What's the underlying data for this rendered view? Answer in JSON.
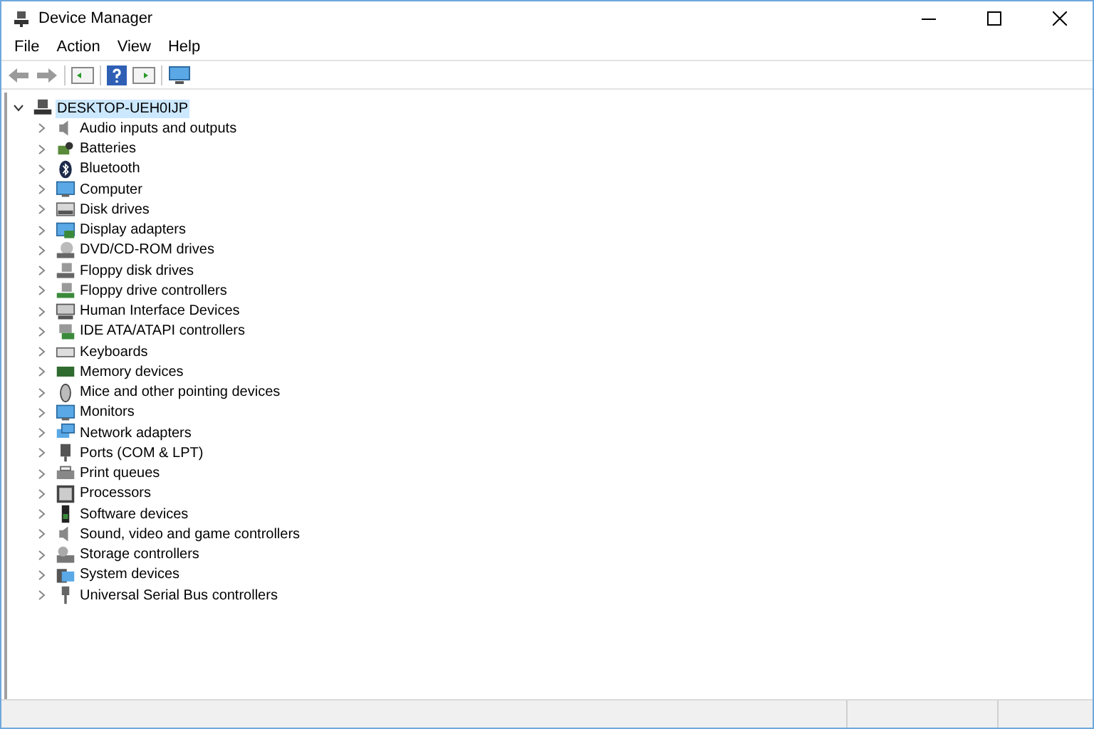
{
  "window": {
    "title": "Device Manager"
  },
  "menu": [
    "File",
    "Action",
    "View",
    "Help"
  ],
  "tree": {
    "label": "DESKTOP-UEH0IJP",
    "expanded": true,
    "selected": true,
    "children": [
      {
        "label": "Audio inputs and outputs",
        "expanded": false,
        "selected": false
      },
      {
        "label": "Batteries",
        "expanded": false,
        "selected": false
      },
      {
        "label": "Bluetooth",
        "expanded": false,
        "selected": false
      },
      {
        "label": "Computer",
        "expanded": false,
        "selected": false
      },
      {
        "label": "Disk drives",
        "expanded": false,
        "selected": false
      },
      {
        "label": "Display adapters",
        "expanded": false,
        "selected": false
      },
      {
        "label": "DVD/CD-ROM drives",
        "expanded": false,
        "selected": false
      },
      {
        "label": "Floppy disk drives",
        "expanded": false,
        "selected": false
      },
      {
        "label": "Floppy drive controllers",
        "expanded": false,
        "selected": false
      },
      {
        "label": "Human Interface Devices",
        "expanded": false,
        "selected": false
      },
      {
        "label": "IDE ATA/ATAPI controllers",
        "expanded": false,
        "selected": false
      },
      {
        "label": "Keyboards",
        "expanded": false,
        "selected": false
      },
      {
        "label": "Memory devices",
        "expanded": false,
        "selected": false
      },
      {
        "label": "Mice and other pointing devices",
        "expanded": false,
        "selected": false
      },
      {
        "label": "Monitors",
        "expanded": false,
        "selected": false
      },
      {
        "label": "Network adapters",
        "expanded": false,
        "selected": false
      },
      {
        "label": "Ports (COM & LPT)",
        "expanded": false,
        "selected": false
      },
      {
        "label": "Print queues",
        "expanded": false,
        "selected": false
      },
      {
        "label": "Processors",
        "expanded": false,
        "selected": false
      },
      {
        "label": "Software devices",
        "expanded": false,
        "selected": false
      },
      {
        "label": "Sound, video and game controllers",
        "expanded": false,
        "selected": false
      },
      {
        "label": "Storage controllers",
        "expanded": false,
        "selected": false
      },
      {
        "label": "System devices",
        "expanded": false,
        "selected": false
      },
      {
        "label": "Universal Serial Bus controllers",
        "expanded": false,
        "selected": false
      }
    ]
  }
}
